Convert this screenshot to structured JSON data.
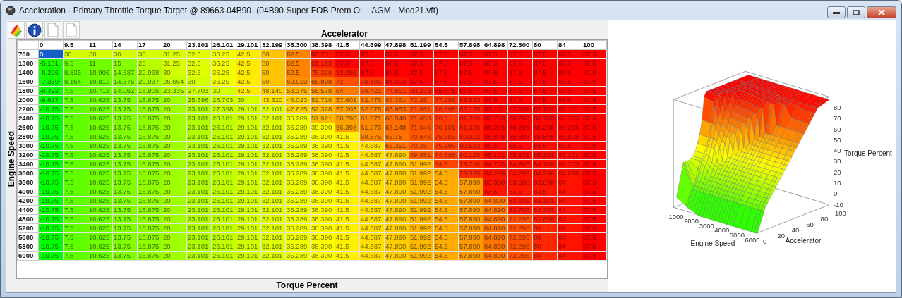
{
  "window": {
    "title": "Acceleration - Primary Throttle Torque Target @ 89663-04B90- (04B90 Super FOB Prem OL - AGM - Mod21.vft)"
  },
  "toolbar": [
    {
      "kind": "palette"
    },
    {
      "kind": "info"
    },
    {
      "kind": "document"
    },
    {
      "kind": "document"
    }
  ],
  "table": {
    "column_axis_label": "Accelerator",
    "row_axis_label": "Engine Speed",
    "value_label": "Torque Percent",
    "columns": [
      "0",
      "9.5",
      "11",
      "14",
      "17",
      "20",
      "23.101",
      "26.101",
      "29.101",
      "32.199",
      "35.300",
      "38.398",
      "41.5",
      "44.699",
      "47.898",
      "51.199",
      "54.5",
      "57.898",
      "64.898",
      "72.300",
      "80",
      "84",
      "100"
    ],
    "rows": [
      {
        "label": "700",
        "cells": [
          {
            "value": "0",
            "selected": true
          },
          "30",
          "30",
          "30",
          "30",
          "31.25",
          "32.5",
          "36.25",
          "42.5",
          "50",
          "62.5",
          "83.75",
          "87.5",
          "87.5",
          "87.5",
          "87.5",
          "87.5",
          "87.5",
          "87.5",
          "87.5",
          "87.5",
          "87.5",
          "87.5"
        ]
      },
      {
        "label": "1300",
        "cells": [
          "-5.101",
          "9.5",
          "11",
          "15",
          "25",
          "31.25",
          "32.5",
          "36.25",
          "42.5",
          "50",
          "62.5",
          "81.125",
          "87.5",
          "87.5",
          "87.5",
          "87.5",
          "87.5",
          "87.5",
          "87.5",
          "87.5",
          "87.5",
          "87.5",
          "87.5"
        ]
      },
      {
        "label": "1400",
        "cells": [
          "-6.226",
          "8.835",
          "10.906",
          "14.687",
          "22.968",
          "30",
          "32.5",
          "36.25",
          "42.5",
          "50",
          "62.5",
          "75.328",
          "82.296",
          "87.5",
          "87.5",
          "87.5",
          "87.5",
          "87.5",
          "87.5",
          "87.5",
          "87.5",
          "87.5",
          "87.5"
        ]
      },
      {
        "label": "1600",
        "cells": [
          "-7.359",
          "8.164",
          "10.812",
          "14.375",
          "20.937",
          "26.664",
          "30",
          "36.25",
          "42.5",
          "50",
          "60.023",
          "65.898",
          "72",
          "78.101",
          "84.203",
          "87.5",
          "87.5",
          "87.5",
          "87.5",
          "87.5",
          "87.5",
          "87.5",
          "87.5"
        ]
      },
      {
        "label": "1800",
        "cells": [
          "-8.492",
          "7.5",
          "10.718",
          "14.062",
          "18.906",
          "23.335",
          "27.703",
          "30",
          "42.5",
          "48.140",
          "53.375",
          "58.578",
          "64",
          "69.421",
          "74.851",
          "80.273",
          "85.875",
          "87.5",
          "87.5",
          "87.5",
          "87.5",
          "87.5",
          "87.5"
        ]
      },
      {
        "label": "2000",
        "cells": [
          "-9.617",
          "7.5",
          "10.625",
          "13.75",
          "16.875",
          "20",
          "25.398",
          "28.703",
          "30",
          "43.320",
          "48.023",
          "52.726",
          "57.601",
          "62.476",
          "67.351",
          "72.25",
          "77.296",
          "82.523",
          "87.5",
          "87.5",
          "87.5",
          "87.5",
          "87.5"
        ]
      },
      {
        "label": "2200",
        "cells": [
          "-10.75",
          "7.5",
          "10.625",
          "13.75",
          "16.875",
          "20",
          "23.101",
          "27.398",
          "29.101",
          "32.101",
          "47.625",
          "52.328",
          "57.203",
          "62.078",
          "66.953",
          "71.851",
          "76.898",
          "82.125",
          "87.101",
          "87.101",
          "87.101",
          "87.101",
          "87.5"
        ]
      },
      {
        "label": "2400",
        "cells": [
          "-10.75",
          "7.5",
          "10.625",
          "13.75",
          "16.875",
          "20",
          "23.101",
          "26.101",
          "29.101",
          "32.101",
          "35.289",
          "51.921",
          "56.796",
          "61.671",
          "66.546",
          "71.453",
          "76.5",
          "81.726",
          "86.703",
          "86.703",
          "86.703",
          "86.703",
          "87.5"
        ]
      },
      {
        "label": "2600",
        "cells": [
          "-10.75",
          "7.5",
          "10.625",
          "13.75",
          "16.875",
          "20",
          "23.101",
          "26.101",
          "29.101",
          "32.101",
          "35.289",
          "39.390",
          "56.398",
          "61.273",
          "66.148",
          "71.046",
          "76.101",
          "81.328",
          "86.296",
          "86.296",
          "86.296",
          "86.296",
          "87.5"
        ]
      },
      {
        "label": "2800",
        "cells": [
          "-10.75",
          "7.5",
          "10.625",
          "13.75",
          "16.875",
          "20",
          "23.101",
          "26.101",
          "29.101",
          "32.101",
          "35.289",
          "38.390",
          "41.5",
          "60.875",
          "65.75",
          "70.648",
          "75.703",
          "80.921",
          "85.898",
          "85.898",
          "85.898",
          "85.898",
          "87.5"
        ]
      },
      {
        "label": "3000",
        "cells": [
          "-10.75",
          "7.5",
          "10.625",
          "13.75",
          "16.875",
          "20",
          "23.101",
          "26.101",
          "29.101",
          "32.101",
          "35.289",
          "38.390",
          "41.5",
          "44.687",
          "65.351",
          "70.25",
          "75.296",
          "80.523",
          "85.5",
          "85.5",
          "85.5",
          "85.5",
          "87.5"
        ]
      },
      {
        "label": "3200",
        "cells": [
          "-10.75",
          "7.5",
          "10.625",
          "13.75",
          "16.875",
          "20",
          "23.101",
          "26.101",
          "29.101",
          "32.101",
          "35.289",
          "38.390",
          "41.5",
          "44.687",
          "47.890",
          "69.851",
          "74.898",
          "80.125",
          "85.101",
          "85.101",
          "85.101",
          "85.101",
          "87.5"
        ]
      },
      {
        "label": "3400",
        "cells": [
          "-10.75",
          "7.5",
          "10.625",
          "13.75",
          "16.875",
          "20",
          "23.101",
          "26.101",
          "29.101",
          "32.101",
          "35.289",
          "38.390",
          "41.5",
          "44.687",
          "47.890",
          "51.992",
          "74.5",
          "79.726",
          "84.703",
          "84.703",
          "84.703",
          "84.703",
          "87.5"
        ]
      },
      {
        "label": "3600",
        "cells": [
          "-10.75",
          "7.5",
          "10.625",
          "13.75",
          "16.875",
          "20",
          "23.101",
          "26.101",
          "29.101",
          "32.101",
          "35.289",
          "38.390",
          "41.5",
          "44.687",
          "47.890",
          "51.992",
          "54.5",
          "79.328",
          "84.296",
          "84.296",
          "84.296",
          "84.296",
          "87.5"
        ]
      },
      {
        "label": "3800",
        "cells": [
          "-10.75",
          "7.5",
          "10.625",
          "13.75",
          "16.875",
          "20",
          "23.101",
          "26.101",
          "29.101",
          "32.101",
          "35.289",
          "38.390",
          "41.5",
          "44.687",
          "47.890",
          "51.992",
          "54.5",
          "57.890",
          "83.898",
          "83.898",
          "83.898",
          "84",
          "87.5"
        ]
      },
      {
        "label": "4000",
        "cells": [
          "-10.75",
          "7.5",
          "10.625",
          "13.75",
          "16.875",
          "20",
          "23.101",
          "26.101",
          "29.101",
          "32.101",
          "35.289",
          "38.390",
          "41.5",
          "44.687",
          "47.890",
          "51.992",
          "54.5",
          "57.890",
          "83.5",
          "83.5",
          "83.5",
          "84",
          "87.5"
        ]
      },
      {
        "label": "4200",
        "cells": [
          "-10.75",
          "7.5",
          "10.625",
          "13.75",
          "16.875",
          "20",
          "23.101",
          "26.101",
          "29.101",
          "32.101",
          "35.289",
          "38.390",
          "41.5",
          "44.687",
          "47.890",
          "51.992",
          "54.5",
          "57.890",
          "64.890",
          "83.101",
          "83.101",
          "84",
          "87.5"
        ]
      },
      {
        "label": "4400",
        "cells": [
          "-10.75",
          "7.5",
          "10.625",
          "13.75",
          "16.875",
          "20",
          "23.101",
          "26.101",
          "29.101",
          "32.101",
          "35.289",
          "38.390",
          "41.5",
          "44.687",
          "47.890",
          "51.992",
          "54.5",
          "57.890",
          "64.890",
          "82.703",
          "82.703",
          "84",
          "87.5"
        ]
      },
      {
        "label": "4800",
        "cells": [
          "-10.75",
          "7.5",
          "10.625",
          "13.75",
          "16.875",
          "20",
          "23.101",
          "26.101",
          "29.101",
          "32.101",
          "35.289",
          "38.390",
          "41.5",
          "44.687",
          "47.890",
          "51.992",
          "54.5",
          "57.890",
          "64.890",
          "72.296",
          "81.898",
          "84",
          "87.5"
        ]
      },
      {
        "label": "5200",
        "cells": [
          "-10.75",
          "7.5",
          "10.625",
          "13.75",
          "16.875",
          "20",
          "23.101",
          "26.101",
          "29.101",
          "32.101",
          "35.289",
          "38.390",
          "41.5",
          "44.687",
          "47.890",
          "51.992",
          "54.5",
          "57.890",
          "64.890",
          "72.296",
          "80",
          "84",
          "87.5"
        ]
      },
      {
        "label": "5600",
        "cells": [
          "-10.75",
          "7.5",
          "10.625",
          "13.75",
          "16.875",
          "20",
          "23.101",
          "26.101",
          "29.101",
          "32.101",
          "35.289",
          "38.390",
          "41.5",
          "44.687",
          "47.890",
          "51.992",
          "54.5",
          "57.890",
          "64.890",
          "72.296",
          "80",
          "84",
          "87.5"
        ]
      },
      {
        "label": "5800",
        "cells": [
          "-10.75",
          "7.5",
          "10.625",
          "13.75",
          "16.875",
          "20",
          "23.101",
          "26.101",
          "29.101",
          "32.101",
          "35.289",
          "38.390",
          "41.5",
          "44.687",
          "47.890",
          "51.992",
          "54.5",
          "57.890",
          "64.890",
          "72.296",
          "80",
          "84",
          "87.5"
        ]
      },
      {
        "label": "6000",
        "cells": [
          "-10.75",
          "7.5",
          "10.625",
          "13.75",
          "16.875",
          "20",
          "23.101",
          "26.101",
          "29.101",
          "32.101",
          "35.289",
          "38.390",
          "41.5",
          "44.687",
          "47.890",
          "51.992",
          "54.5",
          "57.890",
          "64.890",
          "72.296",
          "80",
          "84",
          "87.5"
        ]
      }
    ]
  },
  "plot": {
    "x_label": "Engine Speed",
    "y_label": "Accelerator",
    "z_label": "Torque Percent",
    "x_ticks": [
      "1000",
      "2000",
      "3000",
      "4000",
      "5000",
      "6000"
    ],
    "y_ticks": [
      "0",
      "20",
      "40",
      "60",
      "80",
      "100"
    ],
    "z_ticks": [
      "80",
      "70",
      "60",
      "50",
      "40",
      "30",
      "20",
      "10",
      "0",
      "-10"
    ]
  }
}
